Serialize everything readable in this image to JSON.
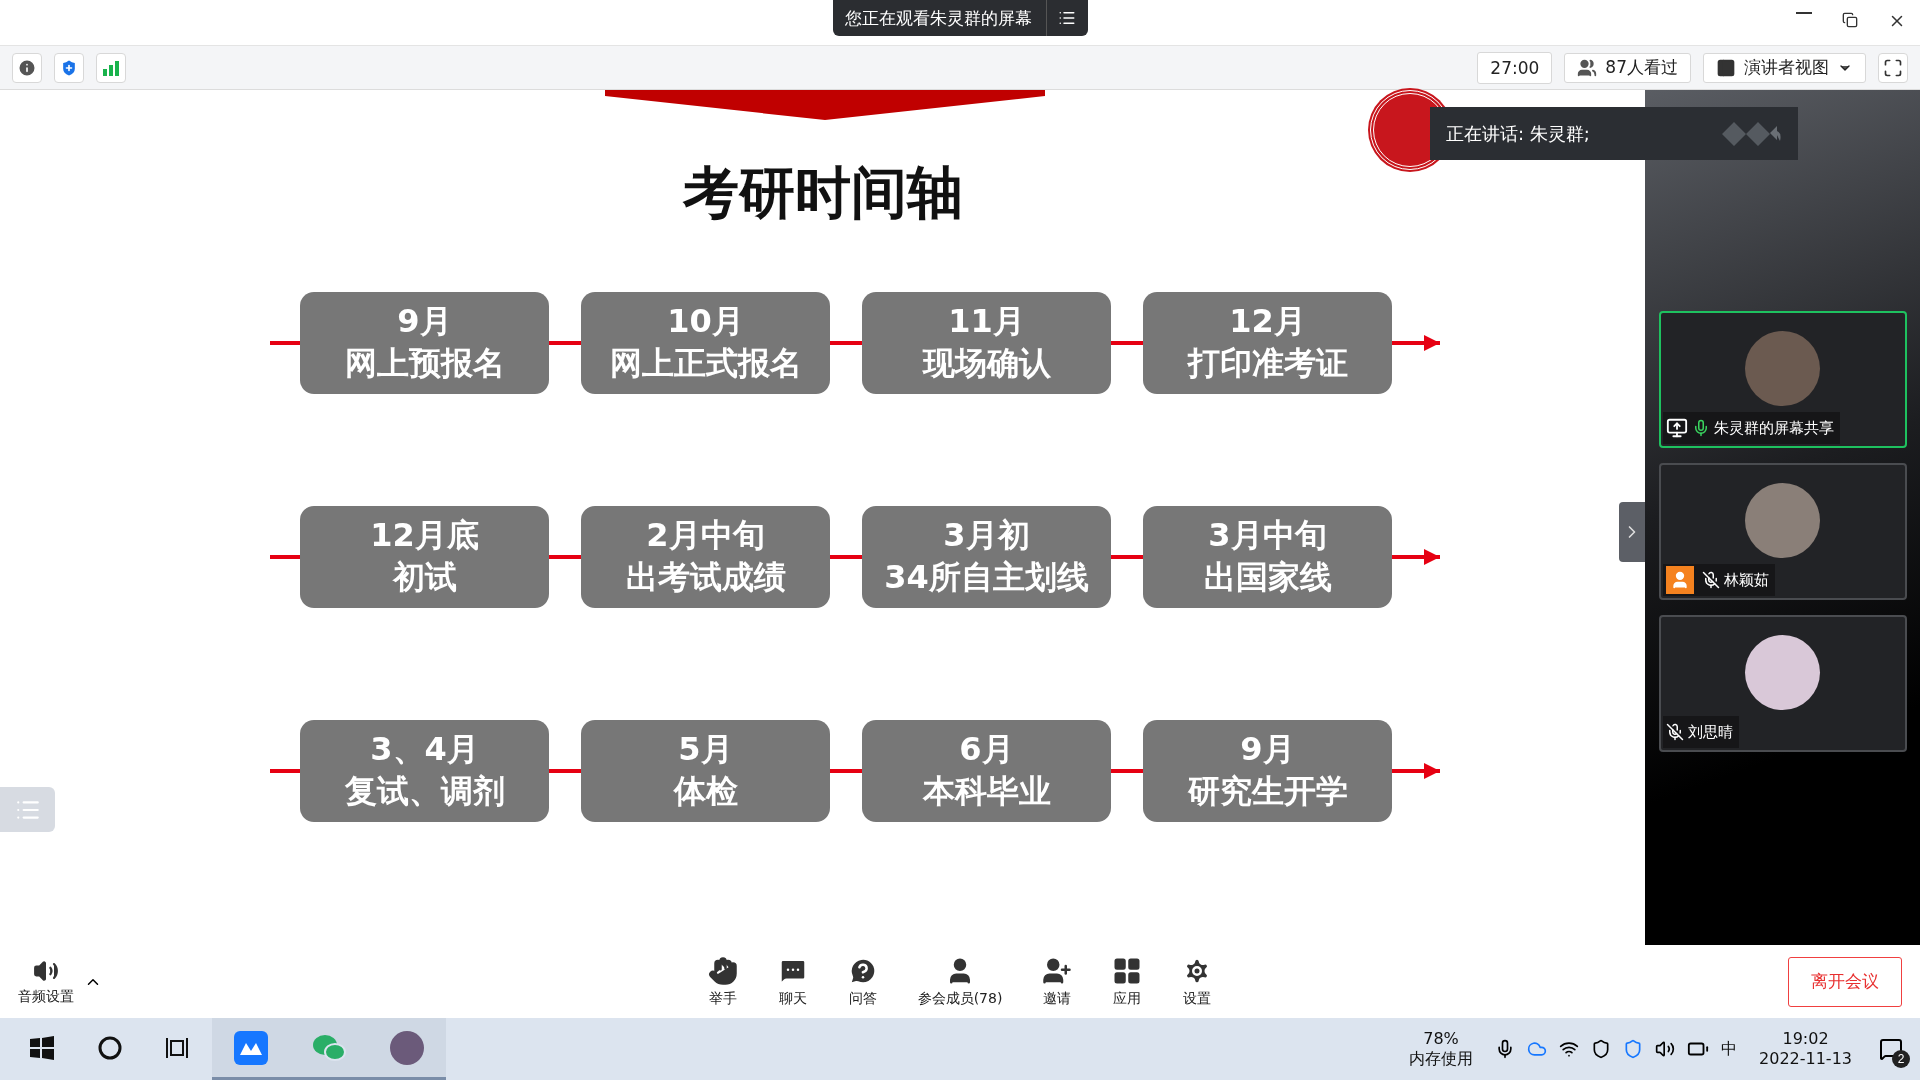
{
  "title_bar": {
    "banner": "您正在观看朱灵群的屏幕"
  },
  "toolbar": {
    "timer": "27:00",
    "viewers": "87人看过",
    "view_mode": "演讲者视图"
  },
  "slide": {
    "title": "考研时间轴",
    "rows": [
      [
        {
          "lines": [
            "9月",
            "网上预报名"
          ]
        },
        {
          "lines": [
            "10月",
            "网上正式报名"
          ]
        },
        {
          "lines": [
            "11月",
            "现场确认"
          ]
        },
        {
          "lines": [
            "12月",
            "打印准考证"
          ]
        }
      ],
      [
        {
          "lines": [
            "12月底",
            "初试"
          ]
        },
        {
          "lines": [
            "2月中旬",
            "出考试成绩"
          ]
        },
        {
          "lines": [
            "3月初",
            "34所自主划线"
          ]
        },
        {
          "lines": [
            "3月中旬",
            "出国家线"
          ]
        }
      ],
      [
        {
          "lines": [
            "3、4月",
            "复试、调剂"
          ]
        },
        {
          "lines": [
            "5月",
            "体检"
          ]
        },
        {
          "lines": [
            "6月",
            "本科毕业"
          ]
        },
        {
          "lines": [
            "9月",
            "研究生开学"
          ]
        }
      ]
    ]
  },
  "speaking": {
    "text": "正在讲话: 朱灵群;"
  },
  "participants": [
    {
      "name": "朱灵群的屏幕共享",
      "muted": false,
      "sharing": true,
      "person_badge": false,
      "selected": true
    },
    {
      "name": "林颖茹",
      "muted": true,
      "sharing": false,
      "person_badge": true,
      "selected": false
    },
    {
      "name": "刘思晴",
      "muted": true,
      "sharing": false,
      "person_badge": false,
      "selected": false
    }
  ],
  "controls": {
    "audio": "音频设置",
    "buttons": [
      {
        "label": "举手",
        "kind": "hand"
      },
      {
        "label": "聊天",
        "kind": "chat"
      },
      {
        "label": "问答",
        "kind": "qa"
      },
      {
        "label": "参会成员(78)",
        "kind": "members"
      },
      {
        "label": "邀请",
        "kind": "invite"
      },
      {
        "label": "应用",
        "kind": "apps"
      },
      {
        "label": "设置",
        "kind": "settings"
      }
    ],
    "leave": "离开会议"
  },
  "taskbar": {
    "apps": [
      {
        "kind": "meeting",
        "running": true
      },
      {
        "kind": "wechat",
        "running": true
      },
      {
        "kind": "photo",
        "running": true
      }
    ],
    "memory_percent": "78%",
    "memory_label": "内存使用",
    "ime": "中",
    "time": "19:02",
    "date": "2022-11-13",
    "notifications": "2"
  }
}
